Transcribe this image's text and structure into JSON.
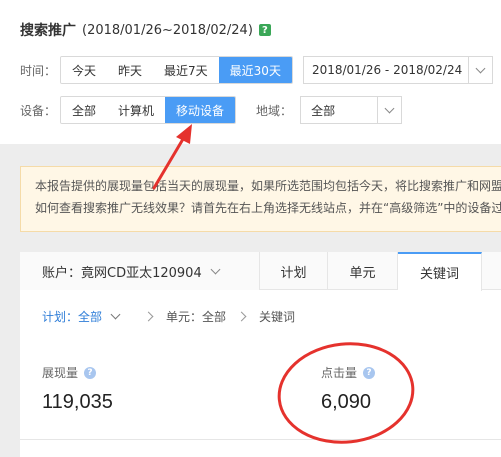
{
  "header": {
    "title": "搜索推广",
    "date_range": "(2018/01/26~2018/02/24)",
    "help_icon": "help-badge-icon"
  },
  "time_filter": {
    "label": "时间：",
    "options": [
      "今天",
      "昨天",
      "最近7天",
      "最近30天"
    ],
    "selected": "最近30天",
    "date_value": "2018/01/26 - 2018/02/24"
  },
  "device_filter": {
    "label": "设备：",
    "options": [
      "全部",
      "计算机",
      "移动设备"
    ],
    "selected": "移动设备",
    "region_label": "地域：",
    "region_value": "全部"
  },
  "notice": {
    "line1": "本报告提供的展现量包括当天的展现量，如果所选范围均包括今天，将比搜索推广和网盟",
    "line2": "如何查看搜索推广无线效果？请首先在右上角选择无线站点，并在“高级筛选”中的设备过"
  },
  "panel": {
    "account_label": "账户：竟网CD亚太120904",
    "tabs": [
      "计划",
      "单元",
      "关键词"
    ],
    "active_tab": "关键词",
    "breadcrumb": {
      "plan": "计划：全部",
      "unit": "单元：全部",
      "keyword": "关键词"
    },
    "metrics": [
      {
        "label": "展现量",
        "value": "119,035"
      },
      {
        "label": "点击量",
        "value": "6,090"
      }
    ]
  },
  "colors": {
    "accent": "#4a9cf5",
    "annotation": "#e5322d",
    "notice_bg": "#fff7e6"
  }
}
